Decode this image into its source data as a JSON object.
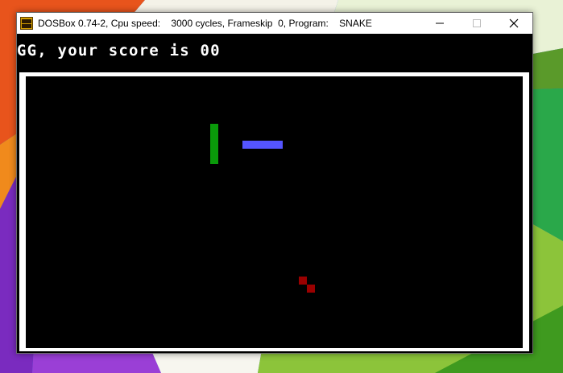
{
  "window": {
    "title": "DOSBox 0.74-2, Cpu speed:    3000 cycles, Frameskip  0, Program:    SNAKE",
    "app_icon": "dosbox-icon",
    "controls": [
      "minimize-icon",
      "maximize-icon",
      "close-icon"
    ]
  },
  "game": {
    "message": "GG, your score is 00",
    "colors": {
      "green_piece": "#0a9a0a",
      "blue_piece": "#5555ff",
      "food": "#9a0000",
      "border": "#ffffff",
      "background": "#000000"
    }
  }
}
